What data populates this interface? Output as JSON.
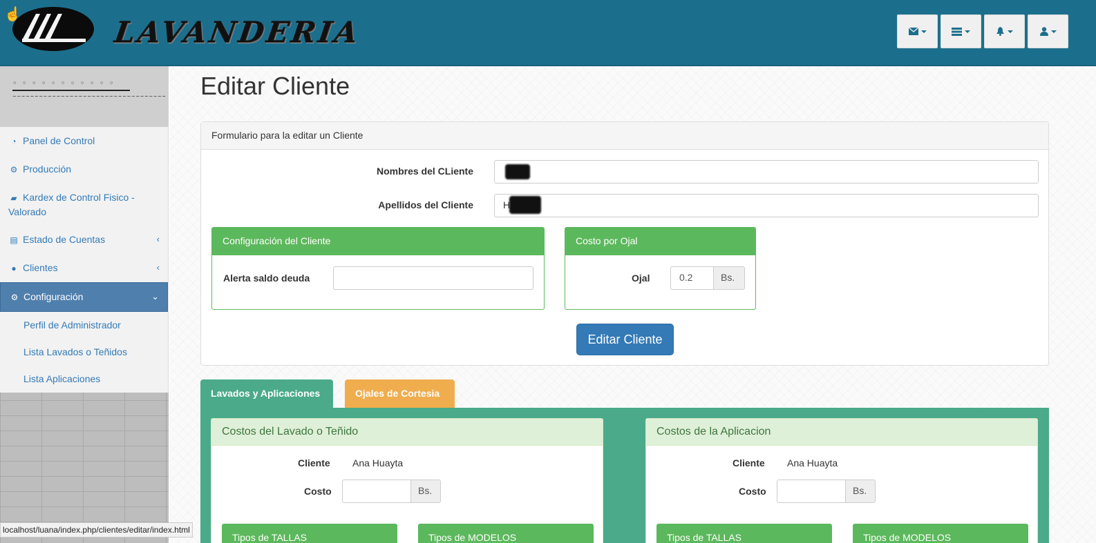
{
  "header": {
    "logo_text": "LAVANDERIA",
    "nav_buttons": [
      {
        "name": "messages-button",
        "icon": "envelope-icon"
      },
      {
        "name": "tasks-button",
        "icon": "tasks-icon"
      },
      {
        "name": "alerts-button",
        "icon": "bell-icon"
      },
      {
        "name": "user-menu-button",
        "icon": "user-icon"
      }
    ]
  },
  "sidebar": {
    "items": [
      {
        "label": "Panel de Control",
        "icon": "dashboard-icon"
      },
      {
        "label": "Producción",
        "icon": "gear-icon"
      },
      {
        "label": "Kardex de Control Fisico - Valorado",
        "icon": "folder-open-icon"
      },
      {
        "label": "Estado de Cuentas",
        "icon": "file-icon",
        "chevron": "‹"
      },
      {
        "label": "Clientes",
        "icon": "user-icon",
        "chevron": "‹"
      },
      {
        "label": "Configuración",
        "icon": "gears-icon",
        "chevron": "⌄"
      }
    ],
    "subitems": [
      {
        "label": "Perfil de Administrador"
      },
      {
        "label": "Lista Lavados o Teñidos"
      },
      {
        "label": "Lista Aplicaciones"
      }
    ]
  },
  "main": {
    "title": "Editar Cliente",
    "form_panel_heading": "Formulario para la editar un Cliente",
    "fields": {
      "nombres_label": "Nombres del CLiente",
      "nombres_value": "",
      "apellidos_label": "Apellidos del Cliente",
      "apellidos_value": "H"
    },
    "config_panel": {
      "heading": "Configuración del Cliente",
      "alerta_label": "Alerta saldo deuda",
      "alerta_value": ""
    },
    "ojal_panel": {
      "heading": "Costo por Ojal",
      "ojal_label": "Ojal",
      "ojal_value": "0.2",
      "currency": "Bs."
    },
    "submit_label": "Editar Cliente"
  },
  "tabs": [
    {
      "label": "Lavados y Aplicaciones",
      "active": true
    },
    {
      "label": "Ojales de Cortesia",
      "active": false
    }
  ],
  "cost_panels": [
    {
      "heading": "Costos del Lavado o Teñido",
      "cliente_label": "Cliente",
      "cliente_value": "Ana Huayta",
      "costo_label": "Costo",
      "costo_value": "",
      "currency": "Bs.",
      "sub_headings": [
        "Tipos de TALLAS",
        "Tipos de MODELOS"
      ]
    },
    {
      "heading": "Costos de la Aplicacion",
      "cliente_label": "Cliente",
      "cliente_value": "Ana Huayta",
      "costo_label": "Costo",
      "costo_value": "",
      "currency": "Bs.",
      "sub_headings": [
        "Tipos de TALLAS",
        "Tipos de MODELOS"
      ]
    }
  ],
  "status_url": "localhost/luana/index.php/clientes/editar/index.html"
}
